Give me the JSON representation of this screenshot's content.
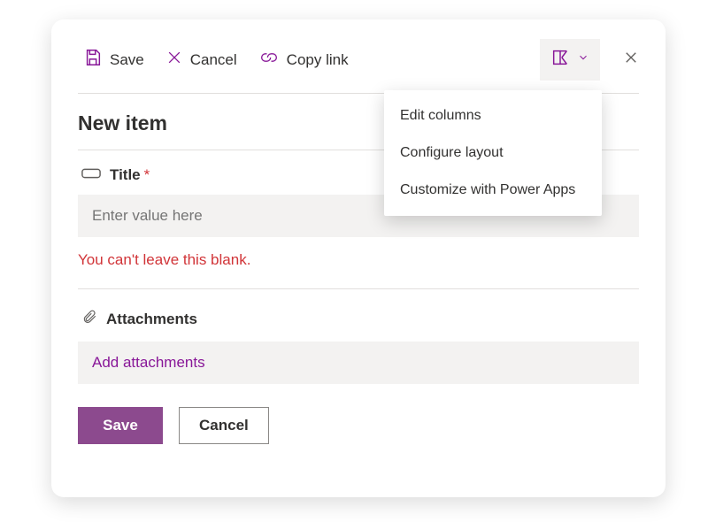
{
  "toolbar": {
    "save_label": "Save",
    "cancel_label": "Cancel",
    "copylink_label": "Copy link"
  },
  "dropdown": {
    "items": [
      {
        "label": "Edit columns"
      },
      {
        "label": "Configure layout"
      },
      {
        "label": "Customize with Power Apps"
      }
    ]
  },
  "form": {
    "heading": "New item",
    "title_field": {
      "label": "Title",
      "required_marker": "*",
      "placeholder": "Enter value here",
      "value": "",
      "error": "You can't leave this blank."
    },
    "attachments": {
      "label": "Attachments",
      "action": "Add attachments"
    }
  },
  "footer": {
    "save_label": "Save",
    "cancel_label": "Cancel"
  }
}
